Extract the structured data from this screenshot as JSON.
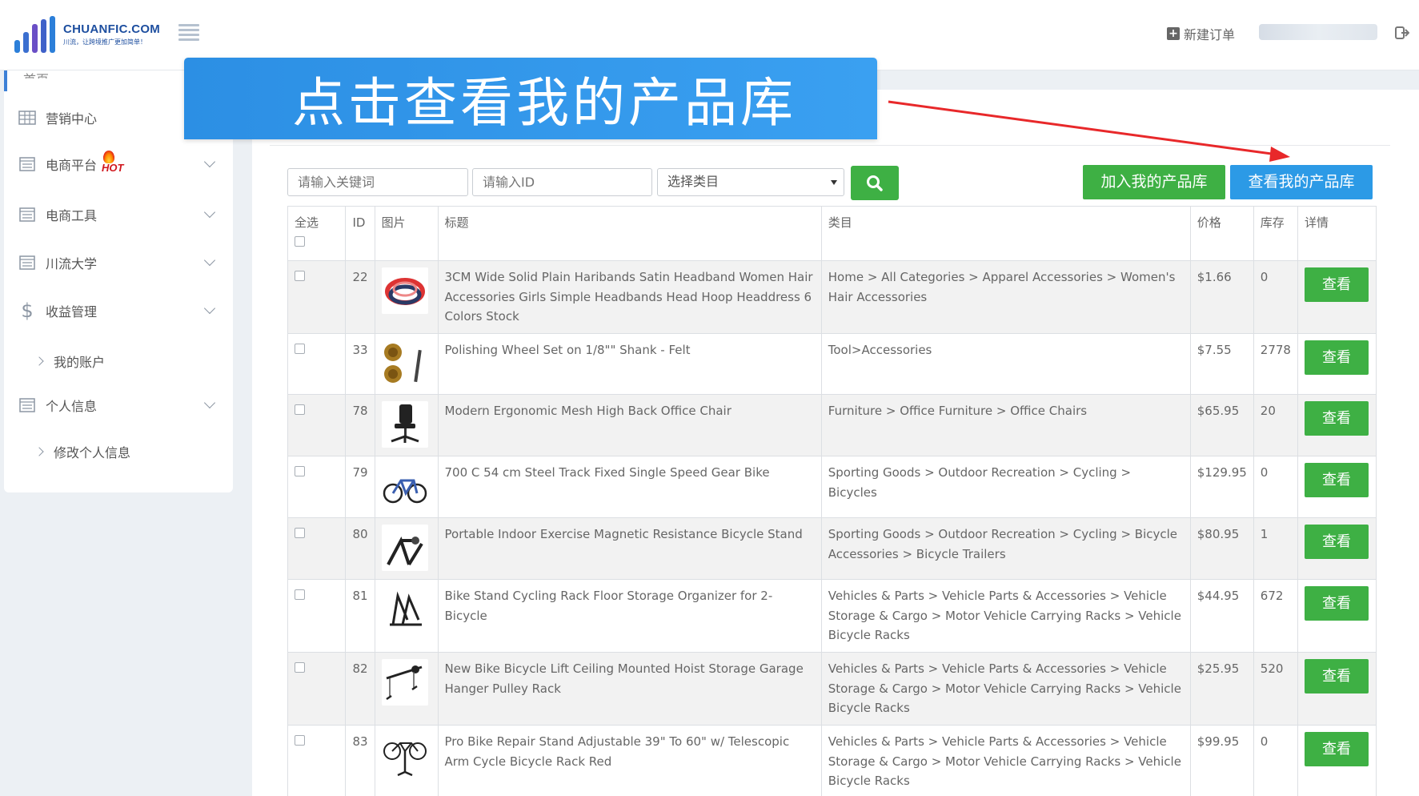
{
  "header": {
    "logo_name": "CHUANFIC.COM",
    "logo_slogan": "川流，让跨境推广更加简单！",
    "new_order_label": "新建订单"
  },
  "sidebar": {
    "home_label": "首页",
    "items": [
      {
        "label": "营销中心",
        "icon": "table-icon"
      },
      {
        "label": "电商平台",
        "icon": "list-icon",
        "badge": "HOT"
      },
      {
        "label": "电商工具",
        "icon": "list-icon"
      },
      {
        "label": "川流大学",
        "icon": "list-icon"
      },
      {
        "label": "收益管理",
        "icon": "dollar-icon"
      },
      {
        "label": "我的账户",
        "icon": "chevron-right-icon"
      },
      {
        "label": "个人信息",
        "icon": "list-icon"
      },
      {
        "label": "修改个人信息",
        "icon": "chevron-right-icon"
      }
    ]
  },
  "banner": {
    "text": "点击查看我的产品库"
  },
  "filters": {
    "keyword_placeholder": "请输入关键词",
    "id_placeholder": "请输入ID",
    "category_value": "选择类目",
    "add_label": "加入我的产品库",
    "view_label": "查看我的产品库"
  },
  "table": {
    "headers": {
      "select_all": "全选",
      "id": "ID",
      "image": "图片",
      "title": "标题",
      "category": "类目",
      "price": "价格",
      "stock": "库存",
      "detail": "详情"
    },
    "view_button": "查看",
    "rows": [
      {
        "id": "22",
        "title": "3CM Wide Solid Plain Haribands Satin Headband Women Hair Accessories Girls Simple Headbands Head Hoop Headdress 6 Colors Stock",
        "category": "Home > All Categories > Apparel Accessories > Women's Hair Accessories",
        "price": "$1.66",
        "stock": "0",
        "image": "headband-image"
      },
      {
        "id": "33",
        "title": "Polishing Wheel Set on 1/8\"\" Shank - Felt",
        "category": "Tool>Accessories",
        "price": "$7.55",
        "stock": "2778",
        "image": "polishing-wheel-image"
      },
      {
        "id": "78",
        "title": "Modern Ergonomic Mesh High Back Office Chair",
        "category": "Furniture > Office Furniture > Office Chairs",
        "price": "$65.95",
        "stock": "20",
        "image": "office-chair-image"
      },
      {
        "id": "79",
        "title": "700 C 54 cm Steel Track Fixed Single Speed Gear Bike",
        "category": "Sporting Goods > Outdoor Recreation > Cycling > Bicycles",
        "price": "$129.95",
        "stock": "0",
        "image": "bicycle-image"
      },
      {
        "id": "80",
        "title": "Portable Indoor Exercise Magnetic Resistance Bicycle Stand",
        "category": "Sporting Goods > Outdoor Recreation > Cycling > Bicycle Accessories > Bicycle Trailers",
        "price": "$80.95",
        "stock": "1",
        "image": "bike-trainer-image"
      },
      {
        "id": "81",
        "title": "Bike Stand Cycling Rack Floor Storage Organizer for 2-Bicycle",
        "category": "Vehicles & Parts > Vehicle Parts & Accessories > Vehicle Storage & Cargo > Motor Vehicle Carrying Racks > Vehicle Bicycle Racks",
        "price": "$44.95",
        "stock": "672",
        "image": "bike-rack-image"
      },
      {
        "id": "82",
        "title": "New Bike Bicycle Lift Ceiling Mounted Hoist Storage Garage Hanger Pulley Rack",
        "category": "Vehicles & Parts > Vehicle Parts & Accessories > Vehicle Storage & Cargo > Motor Vehicle Carrying Racks > Vehicle Bicycle Racks",
        "price": "$25.95",
        "stock": "520",
        "image": "bike-hoist-image"
      },
      {
        "id": "83",
        "title": "Pro Bike Repair Stand Adjustable 39\" To 60\" w/ Telescopic Arm Cycle Bicycle Rack Red",
        "category": "Vehicles & Parts > Vehicle Parts & Accessories > Vehicle Storage & Cargo > Motor Vehicle Carrying Racks > Vehicle Bicycle Racks",
        "price": "$99.95",
        "stock": "0",
        "image": "repair-stand-image"
      }
    ]
  },
  "colors": {
    "accent_blue": "#2c9ae6",
    "accent_green": "#3eb044",
    "arrow_red": "#e8282a"
  }
}
